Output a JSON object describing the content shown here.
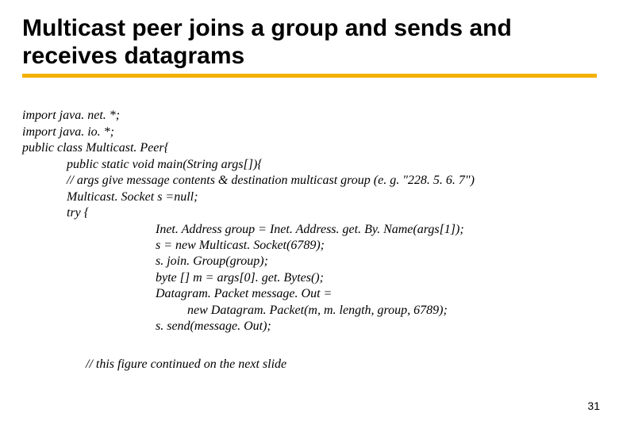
{
  "title_line1": "Multicast peer joins a group and sends and",
  "title_line2": "receives datagrams",
  "code": {
    "l01": "import java. net. *;",
    "l02": "import java. io. *;",
    "l03": "public class Multicast. Peer{",
    "l04": "public static void main(String args[]){",
    "l05": "// args give message contents & destination multicast group (e. g. \"228. 5. 6. 7\")",
    "l06": "Multicast. Socket s =null;",
    "l07": "try {",
    "l08": "Inet. Address group = Inet. Address. get. By. Name(args[1]);",
    "l09": "s = new Multicast. Socket(6789);",
    "l10": "s. join. Group(group);",
    "l11": "byte [] m = args[0]. get. Bytes();",
    "l12": "Datagram. Packet message. Out =",
    "l13": "new Datagram. Packet(m, m. length, group, 6789);",
    "l14": "s. send(message. Out);"
  },
  "note": "// this figure continued on the next slide",
  "page_number": "31"
}
